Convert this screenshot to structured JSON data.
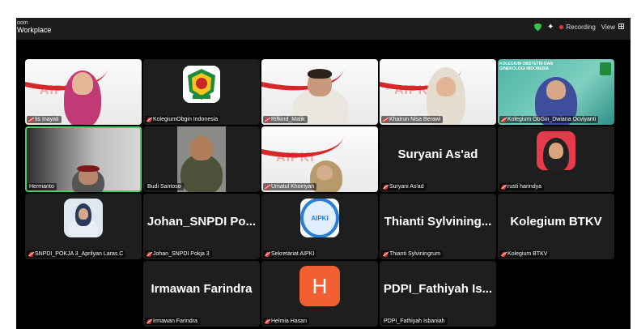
{
  "window": {
    "app_line1": "oom",
    "app_line2": "Workplace",
    "recording_label": "Recording",
    "view_label": "View",
    "shield_color": "#37c24b",
    "record_dot_color": "#e53935"
  },
  "tiles": [
    {
      "name": "Iis Inayati"
    },
    {
      "name": "KolegiumObgin Indonesia"
    },
    {
      "name": "Rifkind_Malik"
    },
    {
      "name": "Khairun Nisa Berawi"
    },
    {
      "name": "Kolegium ObGin_Dwiana Ocviyanti",
      "banner_title": "KOLEGIUM OBSTETRI DAN GINEKOLOGI INDONESIA"
    },
    {
      "name": "Hermanto"
    },
    {
      "name": "Budi Santoso"
    },
    {
      "name": "Umatul Khoiriyah"
    },
    {
      "name": "Suryani As'ad",
      "display_name": "Suryani As'ad"
    },
    {
      "name": "rusti harindya"
    },
    {
      "name": "SNPDI_POKJA 3_Aprilyan Laras C"
    },
    {
      "name": "Johan_SNPDI Pokja 3",
      "display_name": "Johan_SNPDI  Po..."
    },
    {
      "name": "Sekretariat AIPKI",
      "logo_text": "AIPKI"
    },
    {
      "name": "Thianti Sylviningrum",
      "display_name": "Thianti  Sylvining..."
    },
    {
      "name": "Kolegium BTKV",
      "display_name": "Kolegium  BTKV"
    },
    {
      "name": "Irmawan Farindra",
      "display_name": "Irmawan  Farindra"
    },
    {
      "name": "Helmia Hasan",
      "initial": "H",
      "avatar_color": "#f06033"
    },
    {
      "name": "PDPI_Fathiyah Isbaniah",
      "display_name": "PDPI_Fathiyah  Is..."
    }
  ]
}
